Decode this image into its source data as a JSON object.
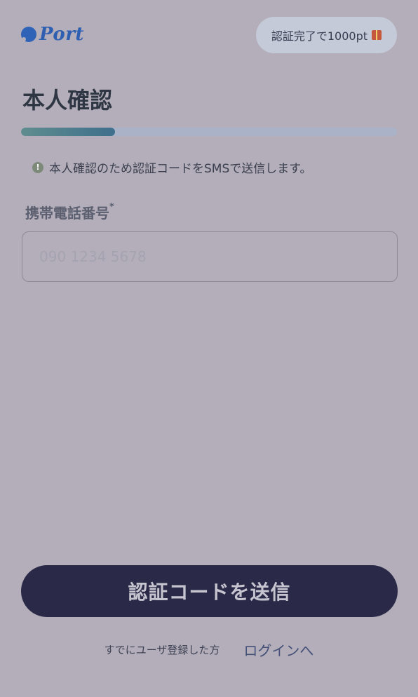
{
  "header": {
    "logo_text": "Port",
    "reward_badge": "認証完了で1000pt"
  },
  "page": {
    "title": "本人確認",
    "progress": 0.25
  },
  "notice": {
    "text": "本人確認のため認証コードをSMSで送信します。"
  },
  "form": {
    "phone_label": "携帯電話番号",
    "required_mark": "*",
    "phone_placeholder": "090 1234 5678",
    "phone_value": ""
  },
  "actions": {
    "submit_label": "認証コードを送信"
  },
  "footer": {
    "registered_text": "すでにユーザ登録した方",
    "login_link": "ログインへ"
  },
  "colors": {
    "brand": "#2f63b8",
    "button": "#2a2a48",
    "progress": "#3f6f8c"
  },
  "icons": {
    "logo": "port-logo-icon",
    "gift": "gift-icon",
    "info": "info-icon"
  }
}
